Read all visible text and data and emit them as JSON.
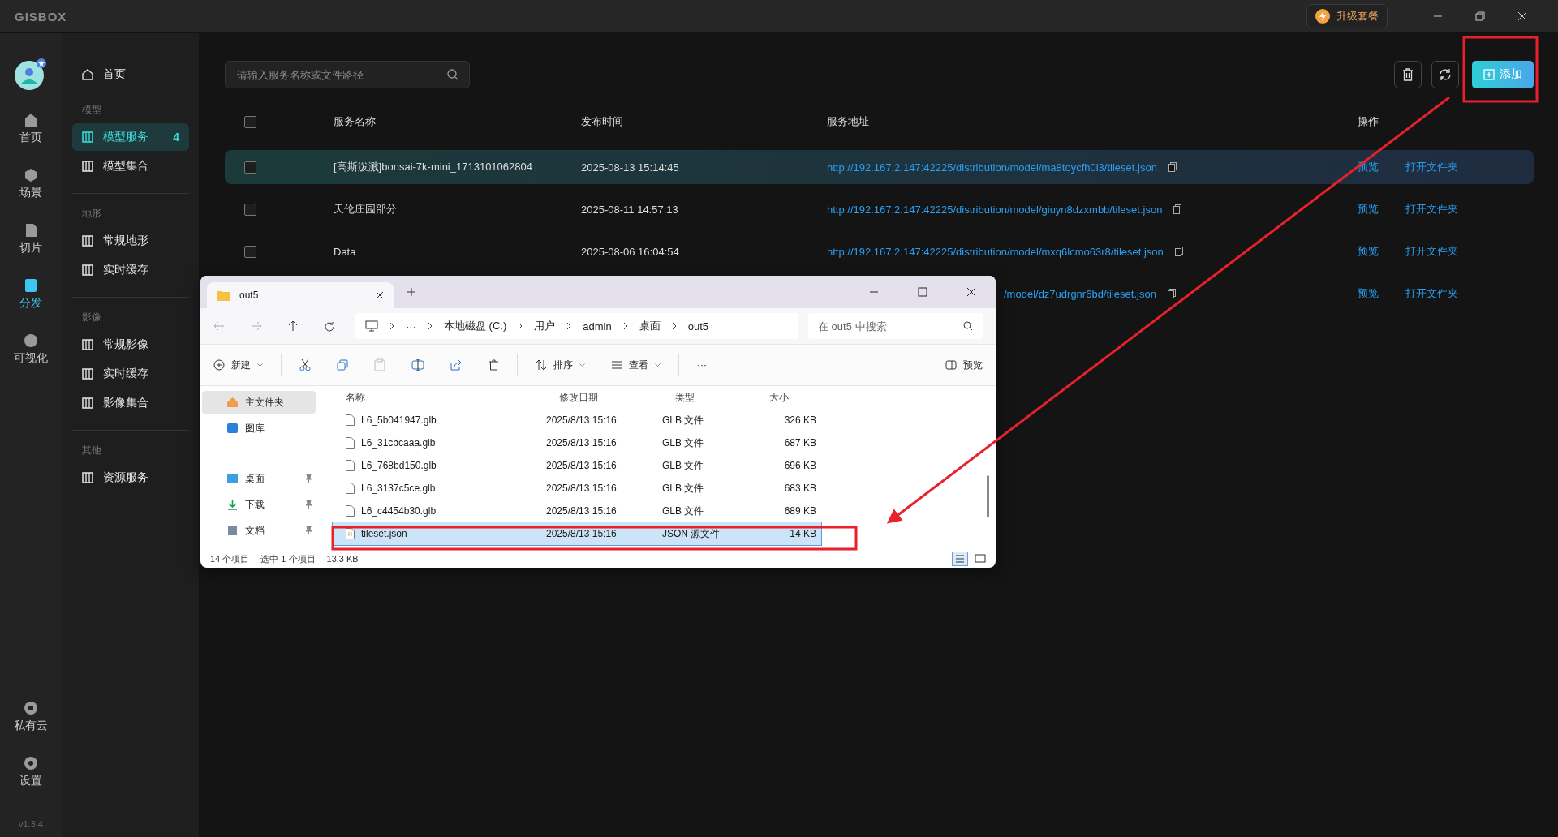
{
  "app": {
    "logo": "GISBOX",
    "upgrade": "升级套餐",
    "version": "v1.3.4"
  },
  "rail": [
    {
      "label": "首页",
      "selected": false
    },
    {
      "label": "场景",
      "selected": false
    },
    {
      "label": "切片",
      "selected": false
    },
    {
      "label": "分发",
      "selected": true
    },
    {
      "label": "可视化",
      "selected": false
    }
  ],
  "rail_bottom": [
    {
      "label": "私有云"
    },
    {
      "label": "设置"
    }
  ],
  "nav": {
    "home": "首页",
    "groups": [
      {
        "title": "模型",
        "items": [
          {
            "label": "模型服务",
            "badge": "4",
            "selected": true
          },
          {
            "label": "模型集合",
            "selected": false
          }
        ]
      },
      {
        "title": "地形",
        "items": [
          {
            "label": "常规地形",
            "selected": false
          },
          {
            "label": "实时缓存",
            "selected": false
          }
        ]
      },
      {
        "title": "影像",
        "items": [
          {
            "label": "常规影像",
            "selected": false
          },
          {
            "label": "实时缓存",
            "selected": false
          },
          {
            "label": "影像集合",
            "selected": false
          }
        ]
      },
      {
        "title": "其他",
        "items": [
          {
            "label": "资源服务",
            "selected": false
          }
        ]
      }
    ]
  },
  "toolbar": {
    "search_placeholder": "请输入服务名称或文件路径",
    "add_button": "添加"
  },
  "table": {
    "select_all_checked": false,
    "columns": [
      "服务名称",
      "发布时间",
      "服务地址",
      "操作"
    ],
    "rows": [
      {
        "name": "[高斯泼溅]bonsai-7k-mini_1713101062804",
        "time": "2025-08-13 15:14:45",
        "url": "http://192.167.2.147:42225/distribution/model/ma8toycfh0l3/tileset.json",
        "actions": [
          "预览",
          "打开文件夹"
        ],
        "selected": true,
        "checked": false
      },
      {
        "name": "天伦庄园部分",
        "time": "2025-08-11 14:57:13",
        "url": "http://192.167.2.147:42225/distribution/model/giuyn8dzxmbb/tileset.json",
        "actions": [
          "预览",
          "打开文件夹"
        ],
        "selected": false,
        "checked": false
      },
      {
        "name": "Data",
        "time": "2025-08-06 16:04:54",
        "url": "http://192.167.2.147:42225/distribution/model/mxq6lcmo63r8/tileset.json",
        "actions": [
          "预览",
          "打开文件夹"
        ],
        "selected": false,
        "checked": false
      },
      {
        "kind": "covered",
        "url": "/model/dz7udrgnr6bd/tileset.json",
        "actions": [
          "预览",
          "打开文件夹"
        ],
        "selected": false
      }
    ]
  },
  "explorer": {
    "tab": "out5",
    "overflow": "···",
    "breadcrumb": [
      "本地磁盘 (C:)",
      "用户",
      "admin",
      "桌面",
      "out5"
    ],
    "search_placeholder": "在 out5 中搜索",
    "new": "新建",
    "sort": "排序",
    "view": "查看",
    "more": "···",
    "preview": "预览",
    "nav": [
      {
        "label": "主文件夹",
        "selected": true,
        "pinned": false
      },
      {
        "label": "图库",
        "selected": false,
        "pinned": false
      },
      {
        "label": "桌面",
        "selected": false,
        "pinned": true
      },
      {
        "label": "下载",
        "selected": false,
        "pinned": true
      },
      {
        "label": "文档",
        "selected": false,
        "pinned": true
      }
    ],
    "columns": [
      "名称",
      "修改日期",
      "类型",
      "大小"
    ],
    "files": [
      {
        "name": "L6_5b041947.glb",
        "date": "2025/8/13 15:16",
        "type": "GLB 文件",
        "size": "326 KB",
        "selected": false
      },
      {
        "name": "L6_31cbcaaa.glb",
        "date": "2025/8/13 15:16",
        "type": "GLB 文件",
        "size": "687 KB",
        "selected": false
      },
      {
        "name": "L6_768bd150.glb",
        "date": "2025/8/13 15:16",
        "type": "GLB 文件",
        "size": "696 KB",
        "selected": false
      },
      {
        "name": "L6_3137c5ce.glb",
        "date": "2025/8/13 15:16",
        "type": "GLB 文件",
        "size": "683 KB",
        "selected": false
      },
      {
        "name": "L6_c4454b30.glb",
        "date": "2025/8/13 15:16",
        "type": "GLB 文件",
        "size": "689 KB",
        "selected": false
      },
      {
        "name": "tileset.json",
        "date": "2025/8/13 15:16",
        "type": "JSON 源文件",
        "size": "14 KB",
        "selected": true
      }
    ],
    "status": [
      "14 个项目",
      "选中 1 个项目",
      "13.3 KB"
    ]
  }
}
